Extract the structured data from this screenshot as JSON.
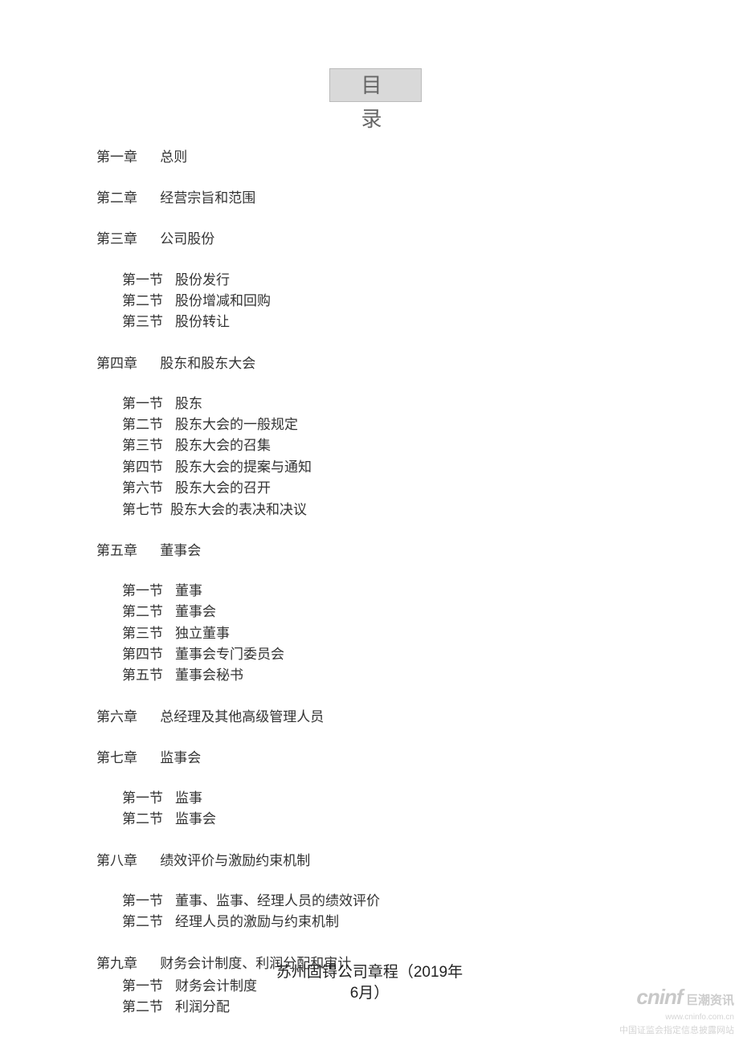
{
  "title": "目录",
  "chapters": [
    {
      "label": "第一章",
      "title": "总则",
      "sections": []
    },
    {
      "label": "第二章",
      "title": "经营宗旨和范围",
      "sections": []
    },
    {
      "label": "第三章",
      "title": "公司股份",
      "sections": [
        {
          "label": "第一节",
          "title": "股份发行"
        },
        {
          "label": "第二节",
          "title": "股份增减和回购"
        },
        {
          "label": "第三节",
          "title": "股份转让"
        }
      ]
    },
    {
      "label": "第四章",
      "title": "股东和股东大会",
      "sections": [
        {
          "label": "第一节",
          "title": "股东"
        },
        {
          "label": "第二节",
          "title": "股东大会的一般规定"
        },
        {
          "label": "第三节",
          "title": "股东大会的召集"
        },
        {
          "label": "第四节",
          "title": "股东大会的提案与通知"
        },
        {
          "label": "第六节",
          "title": "股东大会的召开"
        },
        {
          "label": "第七节",
          "title": "股东大会的表决和决议",
          "tight": true
        }
      ]
    },
    {
      "label": "第五章",
      "title": "董事会",
      "sections": [
        {
          "label": "第一节",
          "title": "董事"
        },
        {
          "label": "第二节",
          "title": "董事会"
        },
        {
          "label": "第三节",
          "title": "独立董事"
        },
        {
          "label": "第四节",
          "title": "董事会专门委员会"
        },
        {
          "label": "第五节",
          "title": "董事会秘书"
        }
      ]
    },
    {
      "label": "第六章",
      "title": "总经理及其他高级管理人员",
      "sections": []
    },
    {
      "label": "第七章",
      "title": "监事会",
      "sections": [
        {
          "label": "第一节",
          "title": "监事"
        },
        {
          "label": "第二节",
          "title": "监事会"
        }
      ]
    },
    {
      "label": "第八章",
      "title": "绩效评价与激励约束机制",
      "sections": [
        {
          "label": "第一节",
          "title": "董事、监事、经理人员的绩效评价"
        },
        {
          "label": "第二节",
          "title": "经理人员的激励与约束机制"
        }
      ]
    },
    {
      "label": "第九章",
      "title": "财务会计制度、利润分配和审计",
      "inline_sections": true,
      "sections": [
        {
          "label": "第一节",
          "title": "财务会计制度"
        },
        {
          "label": "第二节",
          "title": "利润分配"
        }
      ]
    }
  ],
  "footer": {
    "line1": "苏州固锝公司章程（2019年",
    "line2": "6月）"
  },
  "watermark": {
    "brand_en": "cninf",
    "brand_cn": "巨潮资讯",
    "url": "www.cninfo.com.cn",
    "desc": "中国证监会指定信息披露网站"
  }
}
